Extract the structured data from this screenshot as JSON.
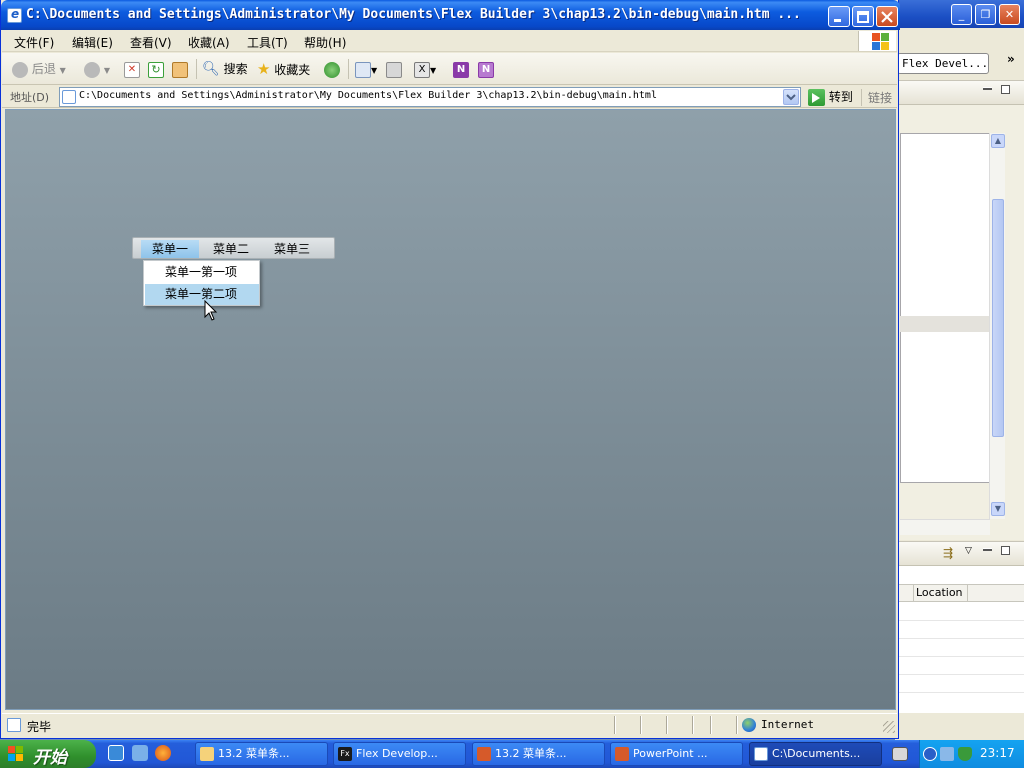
{
  "ie": {
    "title": "C:\\Documents and Settings\\Administrator\\My Documents\\Flex Builder 3\\chap13.2\\bin-debug\\main.htm ...",
    "menus": [
      "文件(F)",
      "编辑(E)",
      "查看(V)",
      "收藏(A)",
      "工具(T)",
      "帮助(H)"
    ],
    "toolbar": {
      "back": "后退",
      "search": "搜索",
      "favorites": "收藏夹"
    },
    "address": {
      "label": "地址(D)",
      "url": "C:\\Documents and Settings\\Administrator\\My Documents\\Flex Builder 3\\chap13.2\\bin-debug\\main.html",
      "go": "转到",
      "links": "链接"
    },
    "status": {
      "text": "完毕",
      "zone": "Internet"
    }
  },
  "flex": {
    "menus": [
      "菜单一",
      "菜单二",
      "菜单三"
    ],
    "active_menu": "菜单一",
    "dropdown": [
      "菜单一第一项",
      "菜单一第二项"
    ],
    "hovered_item": "菜单一第二项"
  },
  "eclipse": {
    "tab": "Flex Devel...",
    "column_header": "Location"
  },
  "taskbar": {
    "start": "开始",
    "tasks": [
      "13.2 菜单条...",
      "Flex Develop...",
      "13.2 菜单条...",
      "PowerPoint ...",
      "C:\\Documents..."
    ],
    "clock": "23:17"
  },
  "colors": {
    "title_blue": "#0748c9",
    "menu_highlight": "#b2d8f0",
    "start_green": "#2f8f2c",
    "taskbar_blue": "#245edb"
  }
}
